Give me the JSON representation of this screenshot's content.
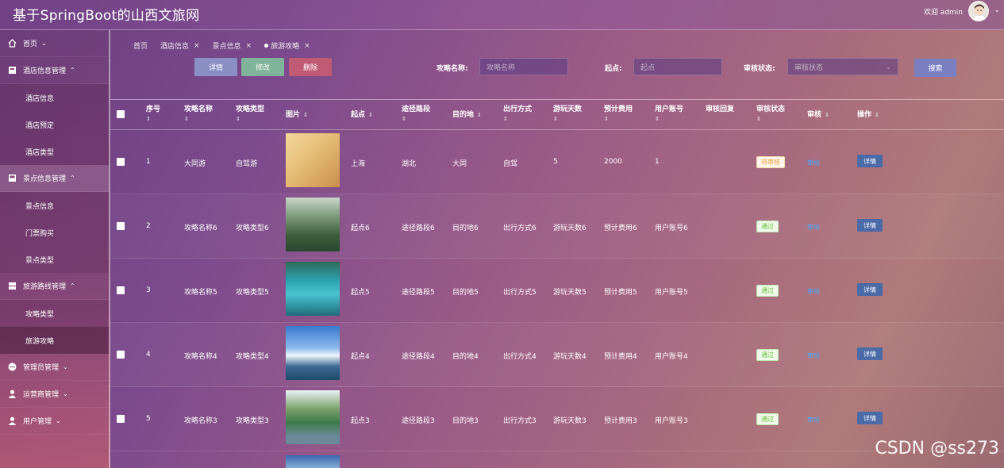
{
  "header": {
    "title": "基于SpringBoot的山西文旅网",
    "welcome": "欢迎 admin"
  },
  "sidebar": {
    "items": [
      {
        "label": "首页",
        "type": "menu",
        "icon": "home-icon",
        "arrow": "⌄"
      },
      {
        "label": "酒店信息管理",
        "type": "menu",
        "icon": "hotel-icon",
        "arrow": "⌃"
      },
      {
        "label": "酒店信息",
        "type": "sub"
      },
      {
        "label": "酒店预定",
        "type": "sub"
      },
      {
        "label": "酒店类型",
        "type": "sub"
      },
      {
        "label": "景点信息管理",
        "type": "menu",
        "icon": "scenic-icon",
        "arrow": "⌃"
      },
      {
        "label": "景点信息",
        "type": "sub"
      },
      {
        "label": "门票购买",
        "type": "sub"
      },
      {
        "label": "景点类型",
        "type": "sub"
      },
      {
        "label": "旅游路线管理",
        "type": "menu",
        "icon": "route-icon",
        "arrow": "⌃"
      },
      {
        "label": "攻略类型",
        "type": "sub"
      },
      {
        "label": "旅游攻略",
        "type": "sub"
      },
      {
        "label": "管理员管理",
        "type": "menu",
        "icon": "admin-icon",
        "arrow": "⌄"
      },
      {
        "label": "运营商管理",
        "type": "menu",
        "icon": "operator-icon",
        "arrow": "⌄"
      },
      {
        "label": "用户管理",
        "type": "menu",
        "icon": "user-icon",
        "arrow": "⌄"
      }
    ]
  },
  "tabs": [
    {
      "label": "首页"
    },
    {
      "label": "酒店信息"
    },
    {
      "label": "景点信息"
    },
    {
      "label": "旅游攻略"
    }
  ],
  "toolbar": {
    "detail": "详情",
    "edit": "修改",
    "delete": "删除",
    "search": "搜索"
  },
  "filters": {
    "name_label": "攻略名称:",
    "name_placeholder": "攻略名称",
    "start_label": "起点:",
    "start_placeholder": "起点",
    "status_label": "审核状态:",
    "status_placeholder": "审核状态"
  },
  "table": {
    "headers": [
      "序号",
      "攻略名称",
      "攻略类型",
      "图片",
      "起点",
      "途径路段",
      "目的地",
      "出行方式",
      "游玩天数",
      "预计费用",
      "用户账号",
      "审核回复",
      "审核状态",
      "审核",
      "操作"
    ],
    "rows": [
      {
        "no": "1",
        "name": "大同游",
        "type": "自驾游",
        "start": "上海",
        "via": "湖北",
        "dest": "大同",
        "mode": "自驾",
        "days": "5",
        "cost": "2000",
        "account": "1",
        "status": "待审核",
        "status_kind": "pending",
        "audit": "审核",
        "op": "详情"
      },
      {
        "no": "2",
        "name": "攻略名称6",
        "type": "攻略类型6",
        "start": "起点6",
        "via": "途径路段6",
        "dest": "目的地6",
        "mode": "出行方式6",
        "days": "游玩天数6",
        "cost": "预计费用6",
        "account": "用户账号6",
        "status": "通过",
        "status_kind": "pass",
        "audit": "审核",
        "op": "详情"
      },
      {
        "no": "3",
        "name": "攻略名称5",
        "type": "攻略类型5",
        "start": "起点5",
        "via": "途径路段5",
        "dest": "目的地5",
        "mode": "出行方式5",
        "days": "游玩天数5",
        "cost": "预计费用5",
        "account": "用户账号5",
        "status": "通过",
        "status_kind": "pass",
        "audit": "审核",
        "op": "详情"
      },
      {
        "no": "4",
        "name": "攻略名称4",
        "type": "攻略类型4",
        "start": "起点4",
        "via": "途径路段4",
        "dest": "目的地4",
        "mode": "出行方式4",
        "days": "游玩天数4",
        "cost": "预计费用4",
        "account": "用户账号4",
        "status": "通过",
        "status_kind": "pass",
        "audit": "审核",
        "op": "详情"
      },
      {
        "no": "5",
        "name": "攻略名称3",
        "type": "攻略类型3",
        "start": "起点3",
        "via": "途径路段3",
        "dest": "目的地3",
        "mode": "出行方式3",
        "days": "游玩天数3",
        "cost": "预计费用3",
        "account": "用户账号3",
        "status": "通过",
        "status_kind": "pass",
        "audit": "审核",
        "op": "详情"
      }
    ]
  },
  "watermark": "CSDN @ss273",
  "colors": {
    "detail_btn": "#8a8fc4",
    "edit_btn": "#7fb39a",
    "delete_btn": "#c15a74",
    "search_btn": "#7a7fc0",
    "link": "#4aa8ff"
  }
}
